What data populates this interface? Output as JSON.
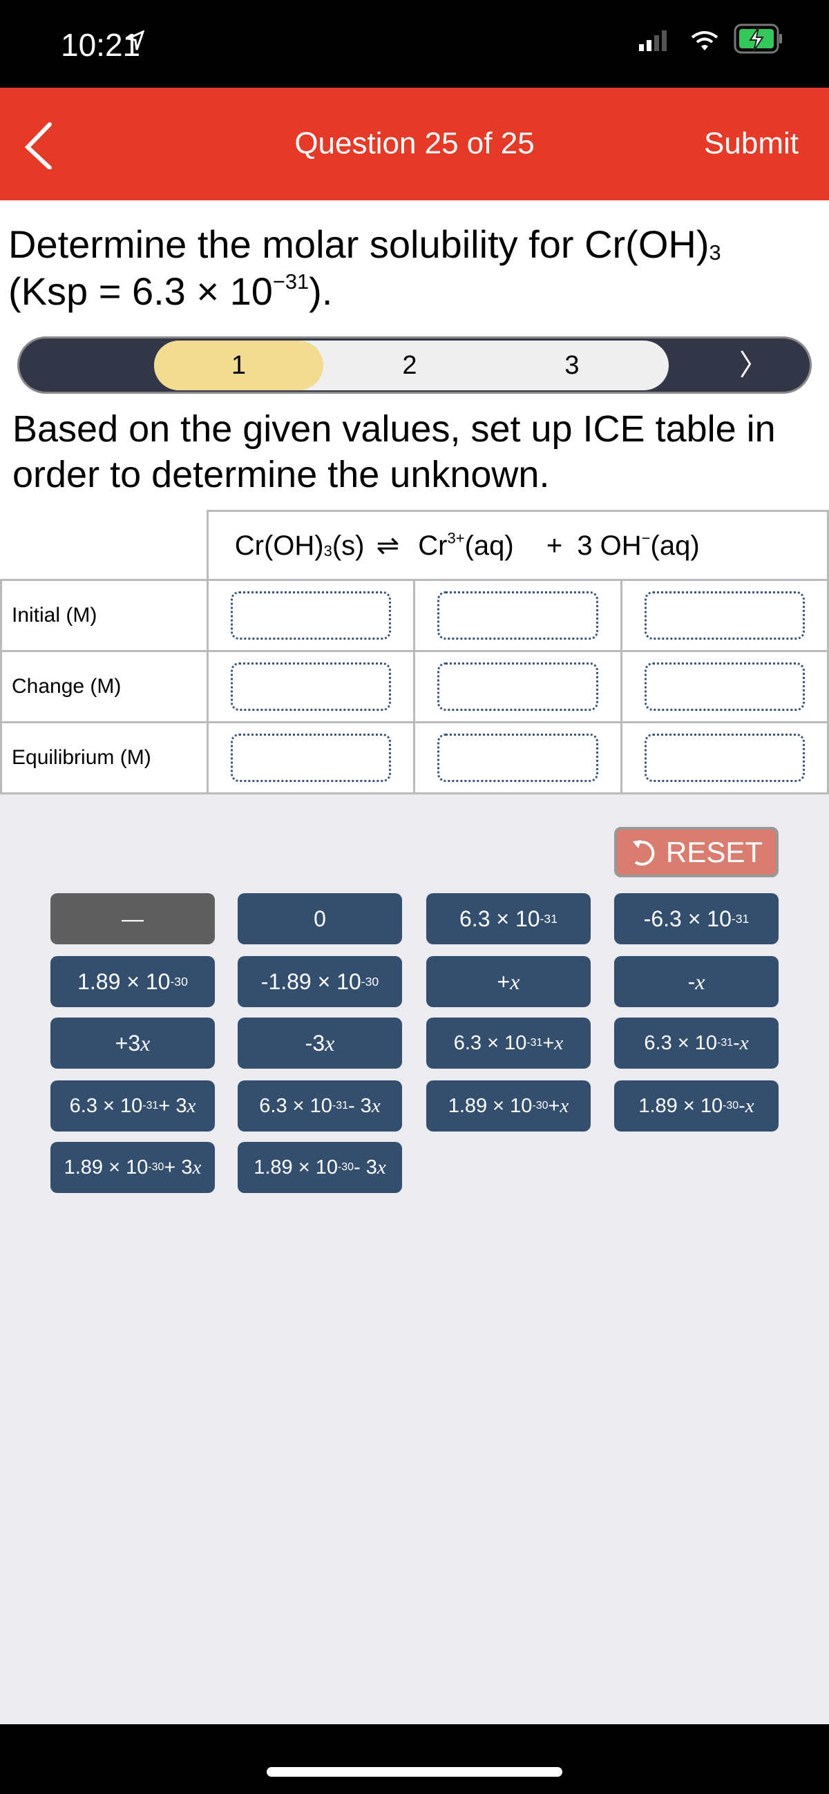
{
  "status_bar": {
    "time": "10:21",
    "location_icon": "location-arrow-icon",
    "signal_icon": "cellular-signal-icon",
    "wifi_icon": "wifi-icon",
    "battery_icon": "battery-charging-icon"
  },
  "nav": {
    "title": "Question 25 of 25",
    "submit": "Submit",
    "back_icon": "chevron-left-icon",
    "color": "#e43a27"
  },
  "question": {
    "line1": "Determine the molar solubility for Cr(OH)",
    "sub": "3",
    "line2a": "(Ksp = 6.3 × 10",
    "sup": "−31",
    "line2b": ")."
  },
  "steps": {
    "items": [
      "1",
      "2",
      "3"
    ],
    "active": "1",
    "next_icon": "chevron-right-icon"
  },
  "instruction": "Based on the given values, set up ICE table in order to determine the unknown.",
  "table": {
    "header": {
      "reactant": "Cr(OH)",
      "reactant_sub": "3",
      "reactant_state": "(s)",
      "arrow": "⇌",
      "product1": "Cr",
      "product1_sup": "3+",
      "product1_state": "(aq)",
      "plus": "+",
      "product2": "3 OH",
      "product2_sup": "−",
      "product2_state": "(aq)"
    },
    "rows": [
      "Initial (M)",
      "Change (M)",
      "Equilibrium (M)"
    ]
  },
  "reset": "RESET",
  "keys": [
    {
      "a": "—"
    },
    {
      "a": "0"
    },
    {
      "a": "6.3 × 10",
      "s": "-31"
    },
    {
      "a": "-6.3 × 10",
      "s": "-31"
    },
    {
      "a": "1.89 × 10",
      "s": "-30"
    },
    {
      "a": "-1.89 × 10",
      "s": "-30"
    },
    {
      "a": "+",
      "x": "x"
    },
    {
      "a": "-",
      "x": "x"
    },
    {
      "a": "+3",
      "x": "x"
    },
    {
      "a": "-3",
      "x": "x"
    },
    {
      "a": "6.3 × 10",
      "s": "-31",
      "b": " + ",
      "x": "x"
    },
    {
      "a": "6.3 × 10",
      "s": "-31",
      "b": " - ",
      "x": "x"
    },
    {
      "a": "6.3 × 10",
      "s": "-31",
      "b": " + 3",
      "x": "x"
    },
    {
      "a": "6.3 × 10",
      "s": "-31",
      "b": " - 3",
      "x": "x"
    },
    {
      "a": "1.89 × 10",
      "s": "-30",
      "b": " + ",
      "x": "x"
    },
    {
      "a": "1.89 × 10",
      "s": "-30",
      "b": " - ",
      "x": "x"
    },
    {
      "a": "1.89 × 10",
      "s": "-30",
      "b": " + 3",
      "x": "x"
    },
    {
      "a": "1.89 × 10",
      "s": "-30",
      "b": " - 3",
      "x": "x"
    }
  ]
}
